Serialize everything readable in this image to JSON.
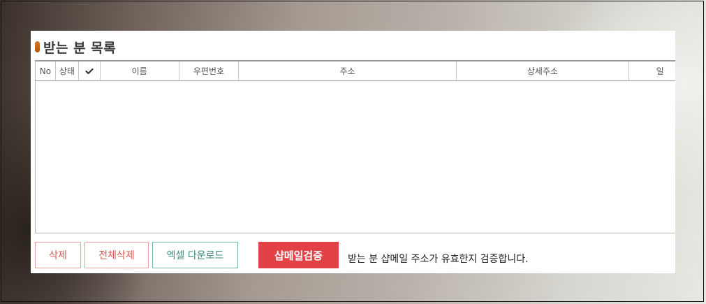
{
  "section": {
    "title": "받는 분 목록"
  },
  "grid": {
    "columns": [
      "No",
      "상태",
      "이름",
      "우편번호",
      "주소",
      "상세주소",
      "일"
    ],
    "check_icon": "checkmark-icon",
    "rows": []
  },
  "actions": {
    "delete_label": "삭제",
    "delete_all_label": "전체삭제",
    "excel_download_label": "엑셀 다운로드",
    "verify_label": "샵메일검증",
    "verify_hint": "받는 분 샵메일 주소가 유효한지 검증합니다."
  },
  "colors": {
    "bullet": "#c8691a",
    "delete_border": "#e2a29e",
    "delete_text": "#d55a52",
    "excel_border": "#7ab3ad",
    "excel_text": "#3e8a82",
    "verify_bg": "#e24145"
  }
}
